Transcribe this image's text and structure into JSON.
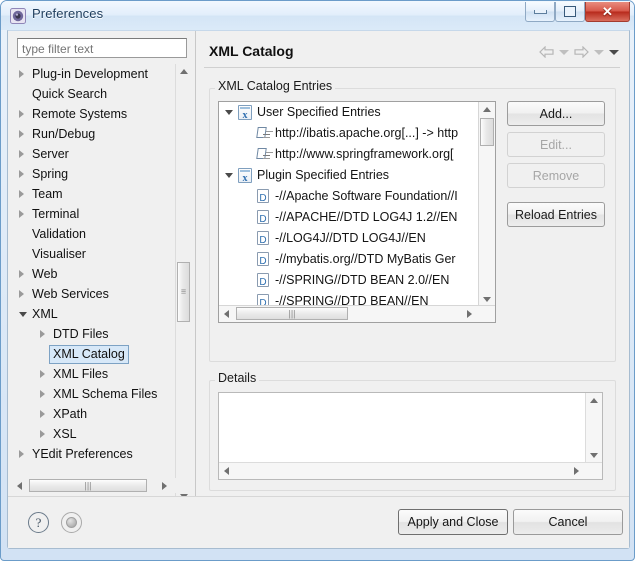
{
  "window": {
    "title": "Preferences",
    "icon": "preferences-gear-icon",
    "controls": {
      "minimize": "minimize-button",
      "maximize": "maximize-button",
      "close_glyph": "✕"
    }
  },
  "sidebar": {
    "filter": {
      "placeholder": "type filter text",
      "value": ""
    },
    "items": [
      {
        "label": "Plug-in Development",
        "level": 1,
        "expandable": true,
        "expanded": false,
        "selected": false
      },
      {
        "label": "Quick Search",
        "level": 1,
        "expandable": false,
        "expanded": false,
        "selected": false
      },
      {
        "label": "Remote Systems",
        "level": 1,
        "expandable": true,
        "expanded": false,
        "selected": false
      },
      {
        "label": "Run/Debug",
        "level": 1,
        "expandable": true,
        "expanded": false,
        "selected": false
      },
      {
        "label": "Server",
        "level": 1,
        "expandable": true,
        "expanded": false,
        "selected": false
      },
      {
        "label": "Spring",
        "level": 1,
        "expandable": true,
        "expanded": false,
        "selected": false
      },
      {
        "label": "Team",
        "level": 1,
        "expandable": true,
        "expanded": false,
        "selected": false
      },
      {
        "label": "Terminal",
        "level": 1,
        "expandable": true,
        "expanded": false,
        "selected": false
      },
      {
        "label": "Validation",
        "level": 1,
        "expandable": false,
        "expanded": false,
        "selected": false
      },
      {
        "label": "Visualiser",
        "level": 1,
        "expandable": false,
        "expanded": false,
        "selected": false
      },
      {
        "label": "Web",
        "level": 1,
        "expandable": true,
        "expanded": false,
        "selected": false
      },
      {
        "label": "Web Services",
        "level": 1,
        "expandable": true,
        "expanded": false,
        "selected": false
      },
      {
        "label": "XML",
        "level": 1,
        "expandable": true,
        "expanded": true,
        "selected": false
      },
      {
        "label": "DTD Files",
        "level": 2,
        "expandable": true,
        "expanded": false,
        "selected": false
      },
      {
        "label": "XML Catalog",
        "level": 2,
        "expandable": false,
        "expanded": false,
        "selected": true
      },
      {
        "label": "XML Files",
        "level": 2,
        "expandable": true,
        "expanded": false,
        "selected": false
      },
      {
        "label": "XML Schema Files",
        "level": 2,
        "expandable": true,
        "expanded": false,
        "selected": false
      },
      {
        "label": "XPath",
        "level": 2,
        "expandable": true,
        "expanded": false,
        "selected": false
      },
      {
        "label": "XSL",
        "level": 2,
        "expandable": true,
        "expanded": false,
        "selected": false
      },
      {
        "label": "YEdit Preferences",
        "level": 1,
        "expandable": true,
        "expanded": false,
        "selected": false
      }
    ]
  },
  "page": {
    "title": "XML Catalog",
    "nav": {
      "back": "back-arrow-icon",
      "back_menu": "back-dropdown-icon",
      "forward": "forward-arrow-icon",
      "forward_menu": "forward-dropdown-icon",
      "view_menu": "view-menu-icon"
    },
    "entries_group": {
      "label": "XML Catalog Entries",
      "rows": [
        {
          "kind": "group",
          "icon": "xml-catalog-group-icon",
          "text": "User Specified Entries",
          "expanded": true
        },
        {
          "kind": "child",
          "icon": "uri-mapping-icon",
          "text": "http://ibatis.apache.org[...] -> http"
        },
        {
          "kind": "child",
          "icon": "uri-mapping-icon",
          "text": "http://www.springframework.org["
        },
        {
          "kind": "group",
          "icon": "xml-catalog-group-icon",
          "text": "Plugin Specified Entries",
          "expanded": true
        },
        {
          "kind": "child",
          "icon": "dtd-icon",
          "text": "-//Apache Software Foundation//I"
        },
        {
          "kind": "child",
          "icon": "dtd-icon",
          "text": "-//APACHE//DTD LOG4J 1.2//EN"
        },
        {
          "kind": "child",
          "icon": "dtd-icon",
          "text": "-//LOG4J//DTD LOG4J//EN"
        },
        {
          "kind": "child",
          "icon": "dtd-icon",
          "text": "-//mybatis.org//DTD MyBatis Ger"
        },
        {
          "kind": "child",
          "icon": "dtd-icon",
          "text": "-//SPRING//DTD BEAN 2.0//EN"
        },
        {
          "kind": "child",
          "icon": "dtd-icon",
          "text": "-//SPRING//DTD BEAN//EN"
        }
      ],
      "buttons": [
        {
          "label": "Add...",
          "enabled": true
        },
        {
          "label": "Edit...",
          "enabled": false
        },
        {
          "label": "Remove",
          "enabled": false
        },
        {
          "label": "Reload Entries",
          "enabled": true
        }
      ]
    },
    "details_group": {
      "label": "Details",
      "content": ""
    }
  },
  "footer": {
    "help_icon": "help-icon",
    "shell_icon": "shell-icon",
    "apply_label": "Apply and Close",
    "cancel_label": "Cancel"
  },
  "colors": {
    "titlebar_text": "#1d3c5c",
    "close_button": "#b72a1c",
    "selection": "#d7e8f8",
    "selection_border": "#7da2c4",
    "dialog_bg": "#f0f0f0",
    "icon_blue": "#2f6fb0"
  }
}
